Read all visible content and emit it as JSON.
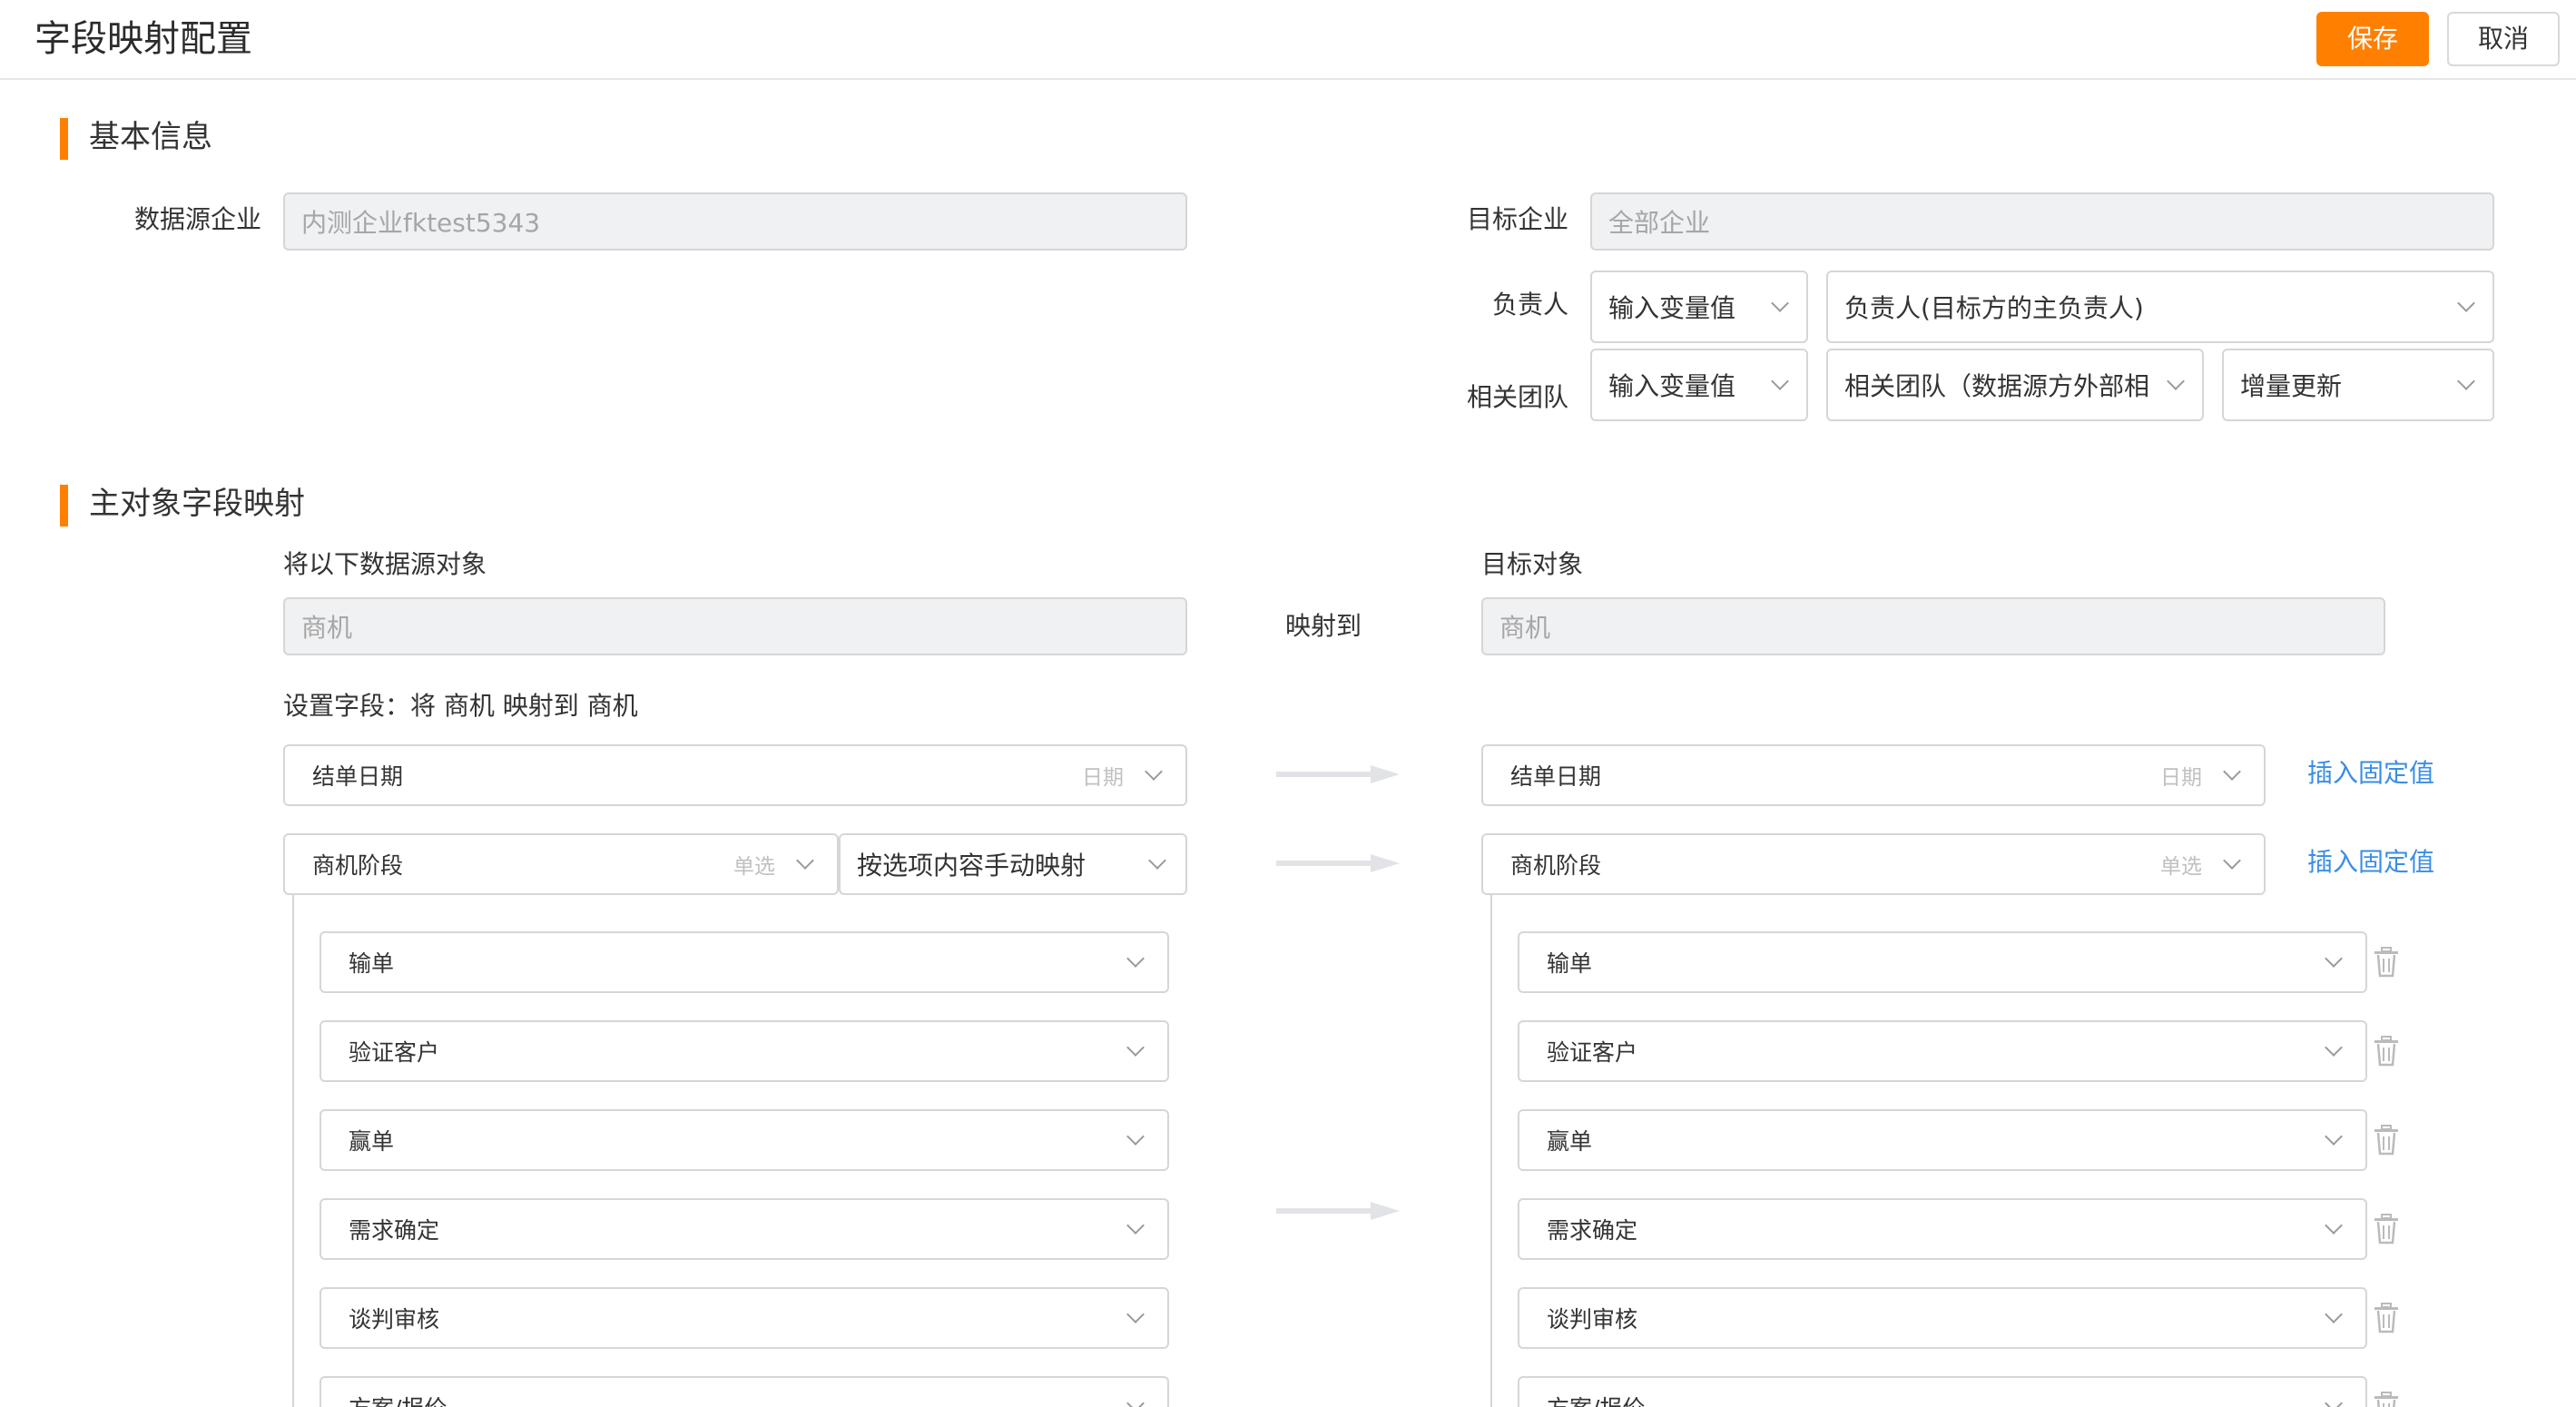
{
  "header": {
    "title": "字段映射配置",
    "save_label": "保存",
    "cancel_label": "取消"
  },
  "basic": {
    "section_title": "基本信息",
    "source_label": "数据源企业",
    "source_value": "内测企业fktest5343",
    "target_label": "目标企业",
    "target_value": "全部企业",
    "owner_label": "负责人",
    "owner_mode": "输入变量值",
    "owner_value": "负责人(目标方的主负责人)",
    "team_label": "相关团队",
    "team_mode": "输入变量值",
    "team_value": "相关团队（数据源方外部相",
    "team_update": "增量更新"
  },
  "mapping": {
    "section_title": "主对象字段映射",
    "source_obj_label": "将以下数据源对象",
    "source_obj_value": "商机",
    "maps_to": "映射到",
    "target_obj_label": "目标对象",
    "target_obj_value": "商机",
    "set_fields_label": "设置字段：将 商机 映射到 商机",
    "insert_fixed": "插入固定值",
    "rows": [
      {
        "source": "结单日期",
        "source_type": "日期",
        "target": "结单日期",
        "target_type": "日期"
      },
      {
        "source": "商机阶段",
        "source_type": "单选",
        "mode": "按选项内容手动映射",
        "target": "商机阶段",
        "target_type": "单选"
      }
    ],
    "options": [
      {
        "source": "输单",
        "target": "输单"
      },
      {
        "source": "验证客户",
        "target": "验证客户"
      },
      {
        "source": "赢单",
        "target": "赢单"
      },
      {
        "source": "需求确定",
        "target": "需求确定"
      },
      {
        "source": "谈判审核",
        "target": "谈判审核"
      },
      {
        "source": "方案/报价",
        "target": "方案/报价"
      }
    ]
  },
  "icons": {
    "dropdown": "chevron-down-icon",
    "delete": "trash-icon",
    "arrow": "arrow-right-icon"
  },
  "colors": {
    "accent": "#ff8000",
    "link": "#3a8ee6",
    "border": "#d6d6d6",
    "disabled_bg": "#f0f1f3"
  }
}
